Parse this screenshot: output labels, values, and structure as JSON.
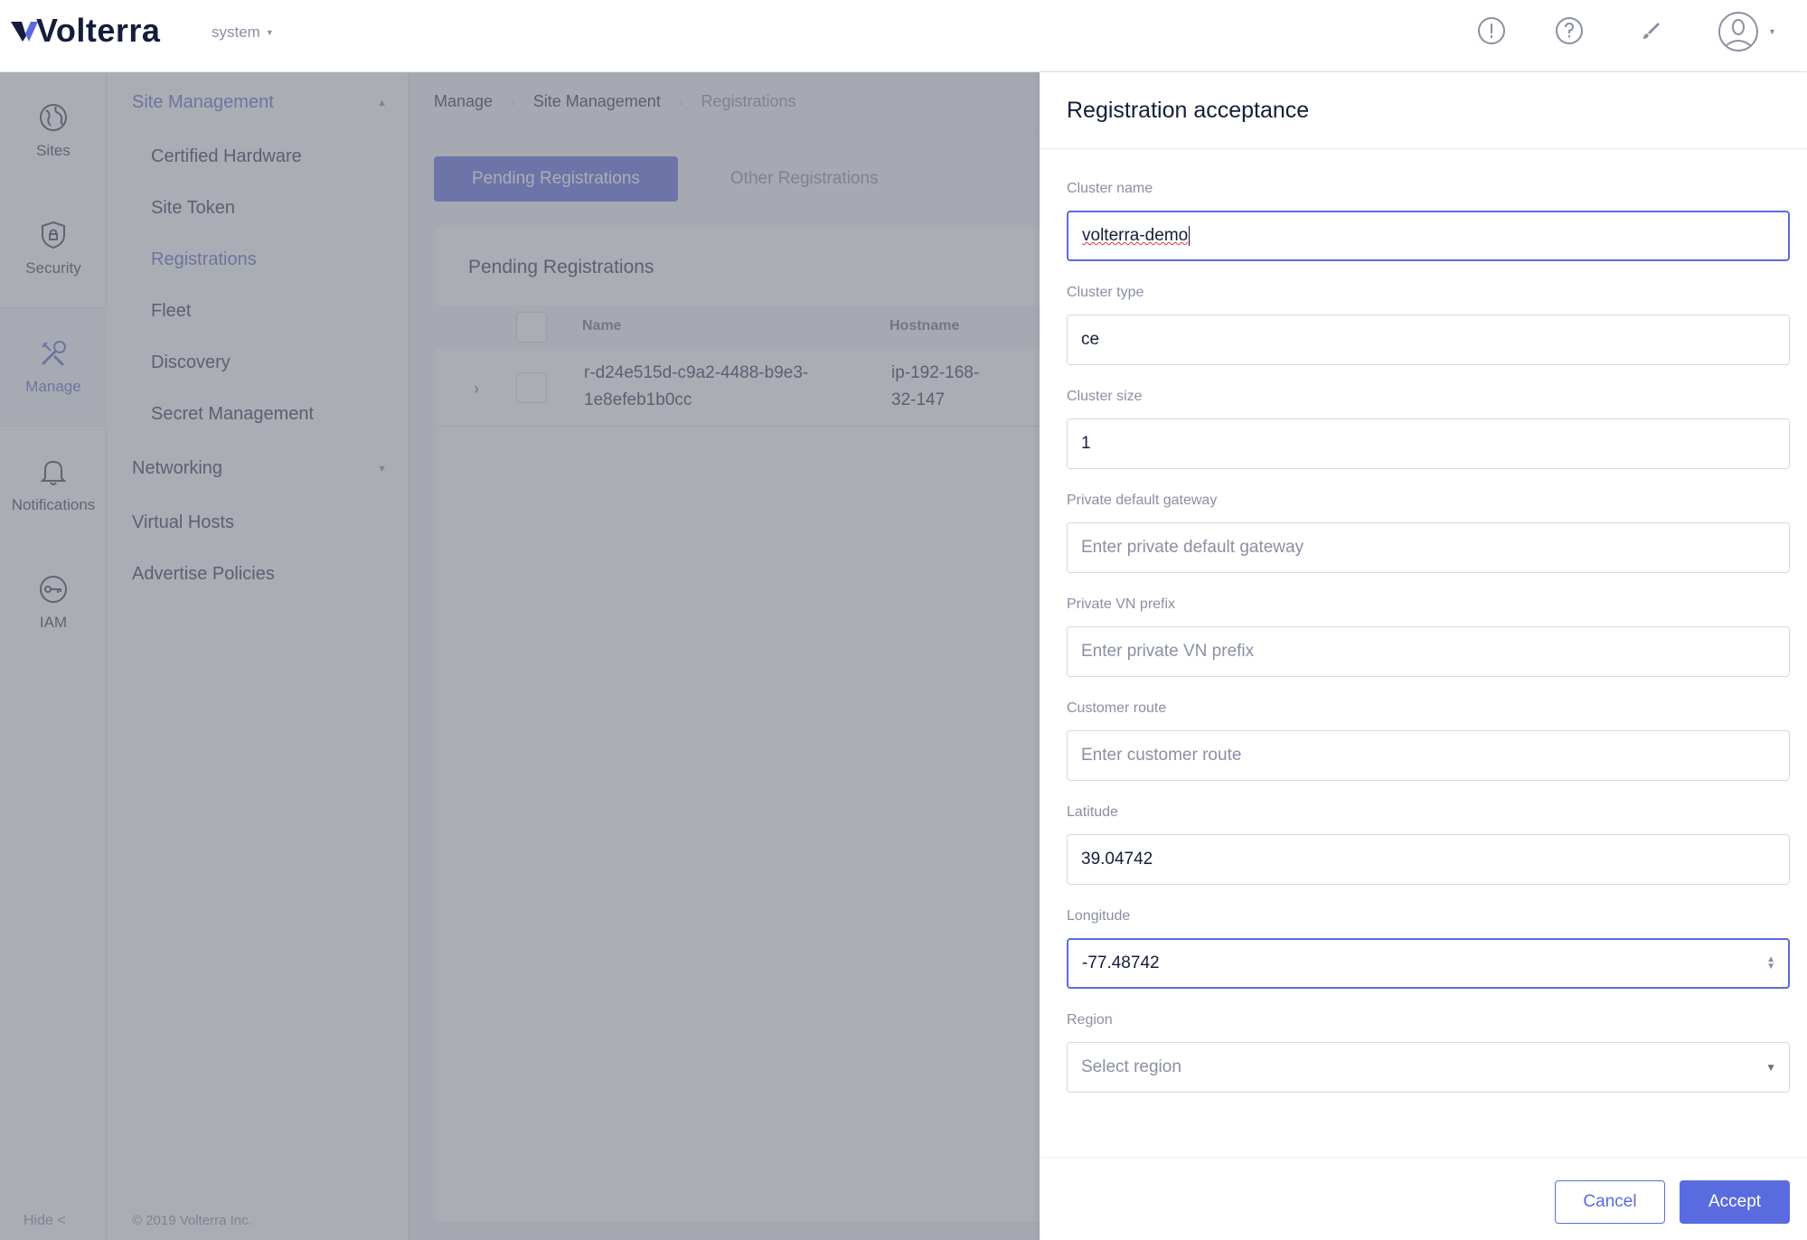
{
  "header": {
    "logo": "Volterra",
    "namespace": "system"
  },
  "rail": {
    "items": [
      {
        "label": "Sites",
        "icon": "globe-icon"
      },
      {
        "label": "Security",
        "icon": "shield-icon"
      },
      {
        "label": "Manage",
        "icon": "tools-icon"
      },
      {
        "label": "Notifications",
        "icon": "bell-icon"
      },
      {
        "label": "IAM",
        "icon": "key-icon"
      }
    ],
    "hide": "Hide <"
  },
  "nav": {
    "site_management": "Site Management",
    "sub_items": [
      "Certified Hardware",
      "Site Token",
      "Registrations",
      "Fleet",
      "Discovery",
      "Secret Management"
    ],
    "networking": "Networking",
    "virtual_hosts": "Virtual Hosts",
    "advertise_policies": "Advertise Policies",
    "copyright": "© 2019 Volterra Inc."
  },
  "breadcrumb": [
    "Manage",
    "Site Management",
    "Registrations"
  ],
  "tabs": [
    "Pending Registrations",
    "Other Registrations"
  ],
  "table": {
    "title": "Pending Registrations",
    "columns": [
      "Name",
      "Hostname"
    ],
    "rows": [
      {
        "name_line1": "r-d24e515d-c9a2-4488-b9e3-",
        "name_line2": "1e8efeb1b0cc",
        "host_line1": "ip-192-168-",
        "host_line2": "32-147"
      }
    ]
  },
  "drawer": {
    "title": "Registration acceptance",
    "fields": {
      "cluster_name": {
        "label": "Cluster name",
        "value": "volterra-demo"
      },
      "cluster_type": {
        "label": "Cluster type",
        "value": "ce"
      },
      "cluster_size": {
        "label": "Cluster size",
        "value": "1"
      },
      "private_gateway": {
        "label": "Private default gateway",
        "placeholder": "Enter private default gateway"
      },
      "private_vn_prefix": {
        "label": "Private VN prefix",
        "placeholder": "Enter private VN prefix"
      },
      "customer_route": {
        "label": "Customer route",
        "placeholder": "Enter customer route"
      },
      "latitude": {
        "label": "Latitude",
        "value": "39.04742"
      },
      "longitude": {
        "label": "Longitude",
        "value": "-77.48742"
      },
      "region": {
        "label": "Region",
        "placeholder": "Select region"
      }
    },
    "cancel": "Cancel",
    "accept": "Accept"
  },
  "colors": {
    "accent": "#5a6be0",
    "text": "#2c3552",
    "muted": "#8a8fa3"
  }
}
